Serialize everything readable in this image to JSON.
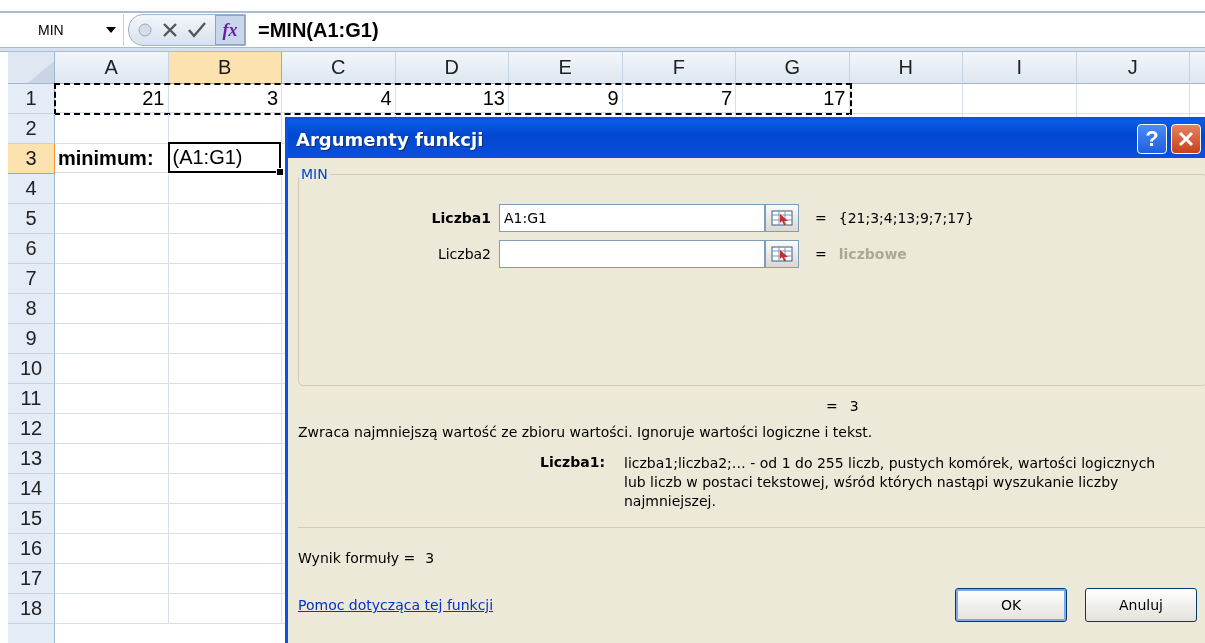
{
  "name_box": {
    "value": "MIN"
  },
  "function_button": "fx",
  "formula": "=MIN(A1:G1)",
  "columns": [
    {
      "label": "A",
      "selected": false
    },
    {
      "label": "B",
      "selected": true
    },
    {
      "label": "C",
      "selected": false
    },
    {
      "label": "D",
      "selected": false
    },
    {
      "label": "E",
      "selected": false
    },
    {
      "label": "F",
      "selected": false
    },
    {
      "label": "G",
      "selected": false
    },
    {
      "label": "H",
      "selected": false
    },
    {
      "label": "I",
      "selected": false
    },
    {
      "label": "J",
      "selected": false
    }
  ],
  "rows": [
    {
      "label": "1",
      "selected": false,
      "marquee": true,
      "cells": [
        {
          "value": "21",
          "kind": "number"
        },
        {
          "value": "3",
          "kind": "number"
        },
        {
          "value": "4",
          "kind": "number"
        },
        {
          "value": "13",
          "kind": "number"
        },
        {
          "value": "9",
          "kind": "number"
        },
        {
          "value": "7",
          "kind": "number"
        },
        {
          "value": "17",
          "kind": "number"
        }
      ]
    },
    {
      "label": "2",
      "selected": false,
      "marquee": false
    },
    {
      "label": "3",
      "selected": true,
      "marquee": false,
      "cells": [
        {
          "value": "minimum:",
          "kind": "text",
          "bold": true,
          "active": false
        },
        {
          "value": "(A1:G1)",
          "kind": "text",
          "bold": false,
          "active": true
        }
      ]
    },
    {
      "label": "4",
      "selected": false,
      "marquee": false
    },
    {
      "label": "5",
      "selected": false,
      "marquee": false
    },
    {
      "label": "6",
      "selected": false,
      "marquee": false
    },
    {
      "label": "7",
      "selected": false,
      "marquee": false
    },
    {
      "label": "8",
      "selected": false,
      "marquee": false
    },
    {
      "label": "9",
      "selected": false,
      "marquee": false
    },
    {
      "label": "10",
      "selected": false,
      "marquee": false
    },
    {
      "label": "11",
      "selected": false,
      "marquee": false
    },
    {
      "label": "12",
      "selected": false,
      "marquee": false
    },
    {
      "label": "13",
      "selected": false,
      "marquee": false
    },
    {
      "label": "14",
      "selected": false,
      "marquee": false
    },
    {
      "label": "15",
      "selected": false,
      "marquee": false
    },
    {
      "label": "16",
      "selected": false,
      "marquee": false
    },
    {
      "label": "17",
      "selected": false,
      "marquee": false
    },
    {
      "label": "18",
      "selected": false,
      "marquee": false
    }
  ],
  "dialog": {
    "title": "Argumenty funkcji",
    "help_button": "?",
    "group_label": "MIN",
    "arguments": [
      {
        "label": "Liczba1",
        "required": true,
        "value": "A1:G1",
        "equals": "=",
        "result": "{21;3;4;13;9;7;17}",
        "muted": false
      },
      {
        "label": "Liczba2",
        "required": false,
        "equals": "=",
        "result": "liczbowe",
        "muted": true
      }
    ],
    "total": {
      "equals": "=",
      "value": "3"
    },
    "description": "Zwraca najmniejszą wartość ze zbioru wartości. Ignoruje wartości logiczne i tekst.",
    "arg_help": {
      "label": "Liczba1:",
      "text": "liczba1;liczba2;… - od 1 do 255 liczb, pustych komórek, wartości logicznych lub liczb w postaci tekstowej, wśród których nastąpi wyszukanie liczby najmniejszej."
    },
    "formula_result": {
      "label": "Wynik formuły =",
      "value": "3"
    },
    "help_link": "Pomoc dotycząca tej funkcji",
    "buttons": [
      {
        "label": "OK",
        "default": true
      },
      {
        "label": "Anuluj",
        "default": false
      }
    ]
  }
}
